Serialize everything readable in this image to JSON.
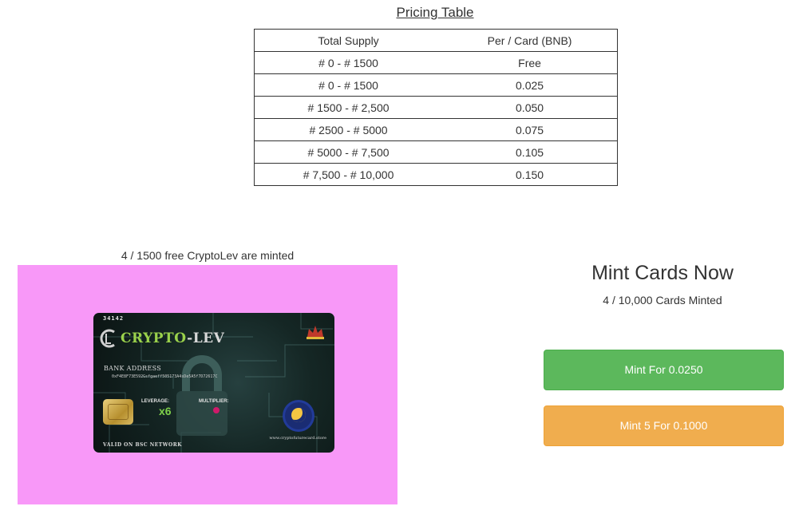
{
  "pricing": {
    "title": "Pricing Table",
    "headers": [
      "Total Supply",
      "Per / Card (BNB)"
    ],
    "rows": [
      [
        "# 0 - # 1500",
        "Free"
      ],
      [
        "# 0 - # 1500",
        "0.025"
      ],
      [
        "# 1500 - # 2,500",
        "0.050"
      ],
      [
        "# 2500 - # 5000",
        "0.075"
      ],
      [
        "# 5000 - # 7,500",
        "0.105"
      ],
      [
        "# 7,500 - # 10,000",
        "0.150"
      ]
    ]
  },
  "free_minted_text": "4 / 1500 free CryptoLev are minted",
  "card": {
    "serial": "34142",
    "brand_part1": "CRYPTO",
    "brand_part2": "-LEV",
    "bank_label": "BANK ADDRESS",
    "bank_address": "0xF4E8F73E592Gsfgaeff505173A4sDe5A5f7D72617C",
    "leverage_label": "LEVERAGE:",
    "leverage_value": "x6",
    "multiplier_label": "MULTIPLIER:",
    "valid_text": "VALID ON BSC NETWORK",
    "site": "www.cryptofuturecard.store",
    "colors": {
      "accent_green": "#7ed04a",
      "panel_pink": "#f898f8"
    }
  },
  "mint": {
    "title": "Mint Cards Now",
    "cards_minted": "4 / 10,000 Cards Minted",
    "button_single": "Mint For 0.0250",
    "button_five": "Mint 5 For 0.1000",
    "colors": {
      "green": "#5cb85c",
      "orange": "#f0ad4e"
    }
  }
}
